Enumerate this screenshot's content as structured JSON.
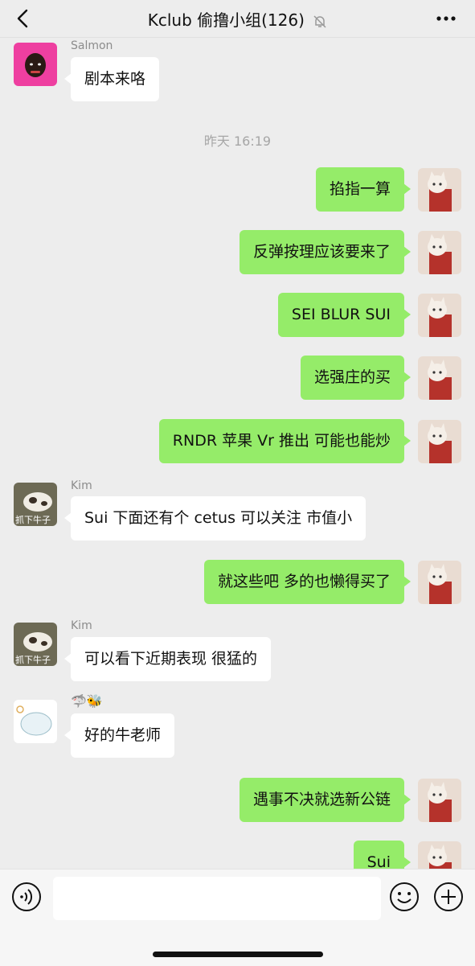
{
  "header": {
    "title": "Kclub 偷撸小组(126)",
    "back_icon": "chevron-left-icon",
    "mute_icon": "bell-muted-icon",
    "more_icon": "ellipsis-icon"
  },
  "chat": {
    "timestamp": "昨天 16:19",
    "messages": [
      {
        "sender": "Salmon",
        "text": "剧本来咯"
      },
      {
        "text": "掐指一算"
      },
      {
        "text": "反弹按理应该要来了"
      },
      {
        "text": "SEI BLUR SUI"
      },
      {
        "text": "选强庄的买"
      },
      {
        "text": "RNDR 苹果 Vr 推出 可能也能炒"
      },
      {
        "sender": "Kim",
        "avatar_caption": "抓下牛子",
        "text": "Sui 下面还有个 cetus 可以关注 市值小"
      },
      {
        "text": "就这些吧 多的也懒得买了"
      },
      {
        "sender": "Kim",
        "avatar_caption": "抓下牛子",
        "text": "可以看下近期表现 很猛的"
      },
      {
        "sender": "🦈🐝",
        "text": "好的牛老师"
      },
      {
        "text": "遇事不决就选新公链"
      },
      {
        "text": "Sui"
      }
    ]
  },
  "inputbar": {
    "voice_icon": "voice-icon",
    "emoji_icon": "emoji-icon",
    "plus_icon": "plus-icon",
    "placeholder": ""
  },
  "colors": {
    "background": "#ededed",
    "outgoing_bubble": "#95ec69",
    "incoming_bubble": "#ffffff"
  }
}
